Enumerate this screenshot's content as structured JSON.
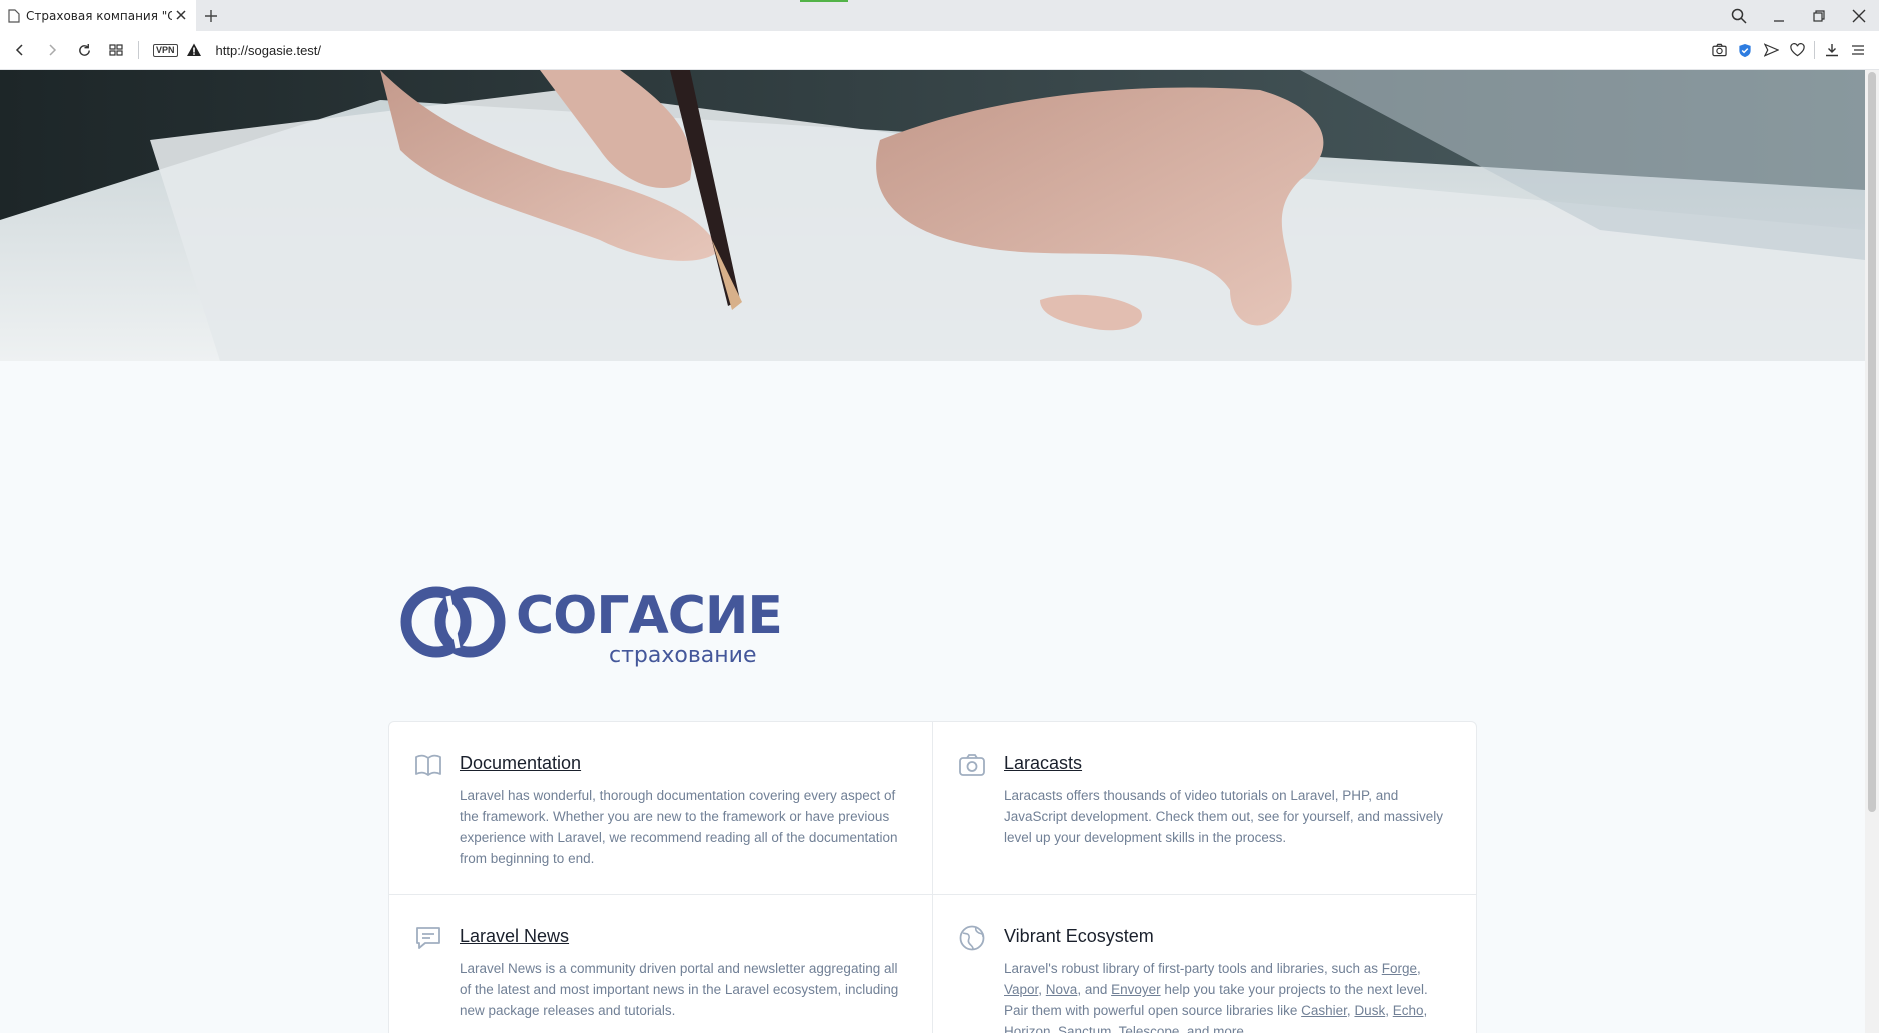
{
  "browser": {
    "tab_title": "Страховая компания \"Сог",
    "url": "http://sogasie.test/",
    "vpn_label": "VPN"
  },
  "logo": {
    "name": "СОГАСИЕ",
    "tagline": "страхование",
    "color": "#44579a"
  },
  "cards": [
    {
      "title": "Documentation",
      "icon": "book-icon",
      "text": "Laravel has wonderful, thorough documentation covering every aspect of the framework. Whether you are new to the framework or have previous experience with Laravel, we recommend reading all of the documentation from beginning to end."
    },
    {
      "title": "Laracasts",
      "icon": "camera-icon",
      "text": "Laracasts offers thousands of video tutorials on Laravel, PHP, and JavaScript development. Check them out, see for yourself, and massively level up your development skills in the process."
    },
    {
      "title": "Laravel News",
      "icon": "chat-icon",
      "text": "Laravel News is a community driven portal and newsletter aggregating all of the latest and most important news in the Laravel ecosystem, including new package releases and tutorials."
    },
    {
      "title": "Vibrant Ecosystem",
      "icon": "globe-icon",
      "text_start": "Laravel's robust library of first-party tools and libraries, such as ",
      "links1": [
        "Forge",
        "Vapor",
        "Nova",
        "Envoyer"
      ],
      "text_mid": " help you take your projects to the next level. Pair them with powerful open source libraries like ",
      "links2": [
        "Cashier",
        "Dusk",
        "Echo",
        "Horizon",
        "Sanctum",
        "Telescope"
      ],
      "text_end": ", and more."
    }
  ]
}
